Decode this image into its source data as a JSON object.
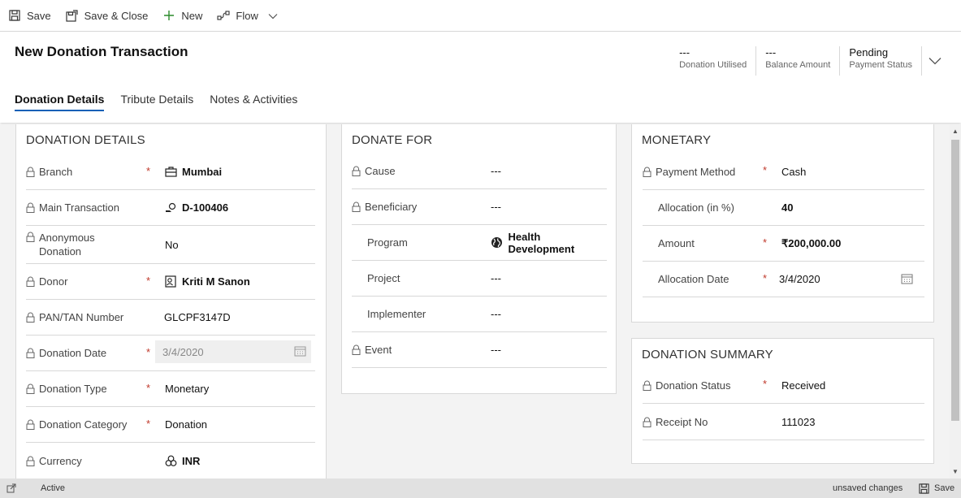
{
  "commandbar": {
    "save": "Save",
    "save_close": "Save & Close",
    "new": "New",
    "flow": "Flow"
  },
  "header": {
    "title": "New Donation Transaction",
    "fields": [
      {
        "value": "---",
        "label": "Donation Utilised"
      },
      {
        "value": "---",
        "label": "Balance Amount"
      },
      {
        "value": "Pending",
        "label": "Payment Status"
      }
    ]
  },
  "tabs": [
    "Donation Details",
    "Tribute Details",
    "Notes & Activities"
  ],
  "donation_details": {
    "title": "DONATION DETAILS",
    "rows": [
      {
        "label": "Branch",
        "value": "Mumbai",
        "required": true,
        "locked": true
      },
      {
        "label": "Main Transaction",
        "value": "D-100406",
        "required": false,
        "locked": true
      },
      {
        "label": "Anonymous Donation",
        "value": "No",
        "required": false,
        "locked": true
      },
      {
        "label": "Donor",
        "value": "Kriti M Sanon",
        "required": true,
        "locked": true
      },
      {
        "label": "PAN/TAN Number",
        "value": "GLCPF3147D",
        "required": false,
        "locked": true
      },
      {
        "label": "Donation Date",
        "value": "3/4/2020",
        "required": true,
        "locked": true
      },
      {
        "label": "Donation Type",
        "value": "Monetary",
        "required": true,
        "locked": true
      },
      {
        "label": "Donation Category",
        "value": "Donation",
        "required": true,
        "locked": true
      },
      {
        "label": "Currency",
        "value": "INR",
        "required": false,
        "locked": true
      }
    ]
  },
  "donate_for": {
    "title": "DONATE FOR",
    "rows": [
      {
        "label": "Cause",
        "value": "---",
        "locked": true
      },
      {
        "label": "Beneficiary",
        "value": "---",
        "locked": true
      },
      {
        "label": "Program",
        "value": "Health Development",
        "locked": false
      },
      {
        "label": "Project",
        "value": "---",
        "locked": false
      },
      {
        "label": "Implementer",
        "value": "---",
        "locked": false
      },
      {
        "label": "Event",
        "value": "---",
        "locked": true
      }
    ]
  },
  "monetary": {
    "title": "MONETARY",
    "rows": [
      {
        "label": "Payment Method",
        "value": "Cash",
        "required": true,
        "locked": true
      },
      {
        "label": "Allocation (in %)",
        "value": "40",
        "required": false,
        "locked": false
      },
      {
        "label": "Amount",
        "value": "₹200,000.00",
        "required": true,
        "locked": false
      },
      {
        "label": "Allocation Date",
        "value": "3/4/2020",
        "required": true,
        "locked": false
      }
    ]
  },
  "donation_summary": {
    "title": "DONATION SUMMARY",
    "rows": [
      {
        "label": "Donation Status",
        "value": "Received",
        "required": true,
        "locked": true
      },
      {
        "label": "Receipt No",
        "value": "111023",
        "required": false,
        "locked": true
      }
    ]
  },
  "statusbar": {
    "status": "Active",
    "unsaved": "unsaved changes",
    "save": "Save"
  }
}
